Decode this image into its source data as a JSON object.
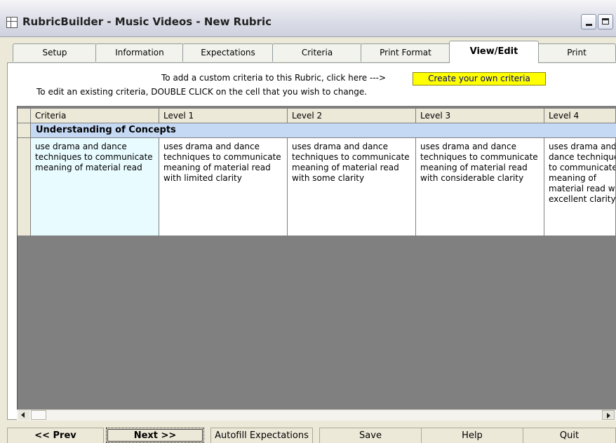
{
  "window": {
    "title": "RubricBuilder  - Music Videos - New Rubric"
  },
  "tabs": [
    {
      "label": "Setup"
    },
    {
      "label": "Information"
    },
    {
      "label": "Expectations"
    },
    {
      "label": "Criteria"
    },
    {
      "label": "Print Format"
    },
    {
      "label": "View/Edit",
      "active": true
    },
    {
      "label": "Print"
    }
  ],
  "instructions": {
    "line1": "To add a custom criteria to this Rubric, click here --->",
    "line2": "To edit an existing criteria, DOUBLE CLICK on the cell that you wish to change.",
    "create_button": "Create your own criteria"
  },
  "grid": {
    "headers": [
      "Criteria",
      "Level 1",
      "Level 2",
      "Level 3",
      "Level 4"
    ],
    "section": "Understanding of Concepts",
    "rows": [
      [
        "use drama and dance techniques to communicate meaning of material read",
        "uses drama and dance techniques to communicate meaning of material read with limited clarity",
        "uses drama and dance techniques to communicate meaning of material read with some clarity",
        "uses drama and dance techniques to communicate meaning of material read with considerable clarity",
        "uses drama and dance techniques to communicate meaning of material read with excellent clarity"
      ]
    ]
  },
  "buttons": {
    "prev": "<< Prev",
    "next": "Next >>",
    "autofill": "Autofill Expectations",
    "save": "Save",
    "help": "Help",
    "quit": "Quit"
  },
  "colors": {
    "section_bg": "#c5d9f5",
    "create_button_bg": "#ffff00",
    "selected_cell_bg": "#e8fbff"
  }
}
